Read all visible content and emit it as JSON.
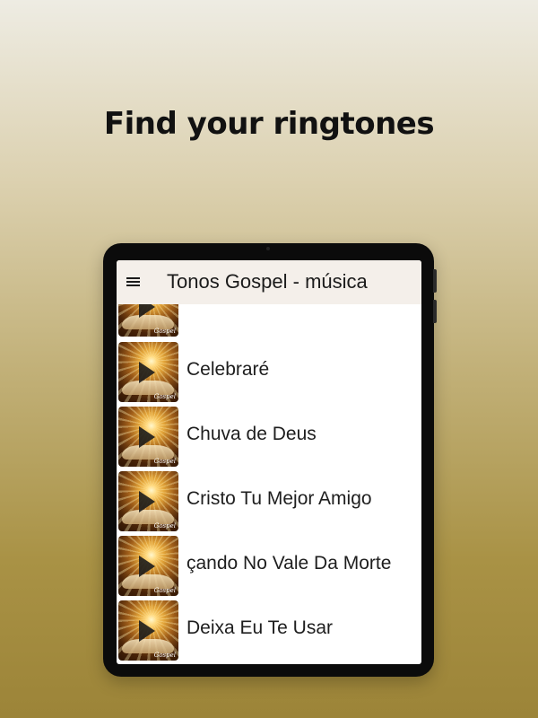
{
  "headline": "Find your ringtones",
  "app": {
    "title": "Tonos Gospel - música",
    "menu_icon": "menu-icon"
  },
  "list": {
    "items": [
      {
        "title": "",
        "thumb_label": "Gospel"
      },
      {
        "title": "Celebraré",
        "thumb_label": "Gospel"
      },
      {
        "title": "Chuva de Deus",
        "thumb_label": "Gospel"
      },
      {
        "title": "Cristo Tu Mejor Amigo",
        "thumb_label": "Gospel"
      },
      {
        "title": "çando No Vale Da Morte",
        "thumb_label": "Gospel"
      },
      {
        "title": "Deixa Eu Te Usar",
        "thumb_label": "Gospel"
      }
    ]
  },
  "colors": {
    "appbar": "#f4efea",
    "background_top": "#eeece3",
    "background_bottom": "#9c8438",
    "tablet_frame": "#0b0b0b"
  }
}
